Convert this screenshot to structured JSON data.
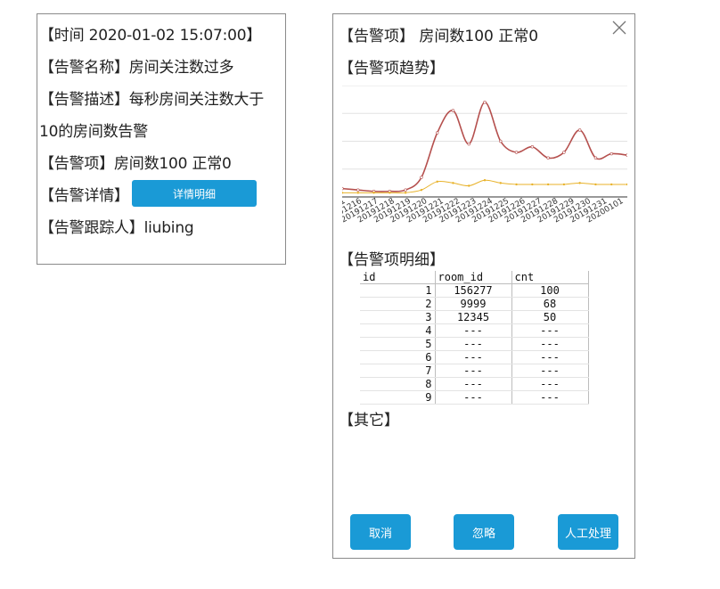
{
  "summary": {
    "time": "【时间 2020-01-02 15:07:00】",
    "alert_name": "【告警名称】房间关注数过多",
    "alert_desc_1": "【告警描述】每秒房间关注数大于",
    "alert_desc_2": "10的房间数告警",
    "alert_item": "【告警项】房间数100 正常0",
    "alert_detail_label": "【告警详情】",
    "detail_button": "详情明细",
    "alert_tracker": "【告警跟踪人】liubing"
  },
  "dialog": {
    "alert_item": "【告警项】 房间数100 正常0",
    "trend_title": "【告警项趋势】",
    "detail_title": "【告警项明细】",
    "other_title": "【其它】",
    "buttons": {
      "cancel": "取消",
      "ignore": "忽略",
      "manual": "人工处理"
    },
    "close_icon": "close-icon"
  },
  "table": {
    "headers": [
      "id",
      "room_id",
      "cnt"
    ],
    "rows": [
      [
        "1",
        "156277",
        "100"
      ],
      [
        "2",
        "9999",
        "68"
      ],
      [
        "3",
        "12345",
        "50"
      ],
      [
        "4",
        "---",
        "---"
      ],
      [
        "5",
        "---",
        "---"
      ],
      [
        "6",
        "---",
        "---"
      ],
      [
        "7",
        "---",
        "---"
      ],
      [
        "8",
        "---",
        "---"
      ],
      [
        "9",
        "---",
        "---"
      ]
    ]
  },
  "chart_data": {
    "type": "line",
    "title": "",
    "categories": [
      "2019121",
      "20191216",
      "20191217",
      "20191218",
      "20191219",
      "20191220",
      "20191221",
      "20191222",
      "20191223",
      "20191224",
      "20191225",
      "20191226",
      "20191227",
      "20191228",
      "20191229",
      "20191230",
      "20191231",
      "20200101"
    ],
    "series": [
      {
        "color": "#b5504e",
        "values": [
          6,
          5,
          4,
          4,
          5,
          14,
          46,
          62,
          38,
          68,
          40,
          32,
          36,
          28,
          32,
          48,
          28,
          31,
          30
        ]
      },
      {
        "color": "#e8b22a",
        "values": [
          3,
          3,
          3,
          3,
          3,
          5,
          11,
          10,
          8,
          12,
          10,
          9,
          9,
          9,
          9,
          10,
          9,
          9,
          9
        ]
      }
    ],
    "ylim": [
      0,
      80
    ],
    "grid": true
  }
}
